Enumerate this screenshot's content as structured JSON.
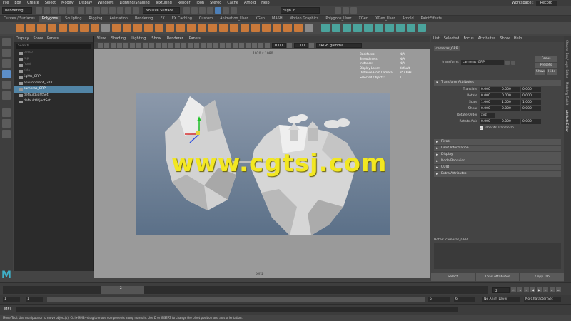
{
  "menubar": {
    "items": [
      "File",
      "Edit",
      "Create",
      "Select",
      "Modify",
      "Display",
      "Windows",
      "Lighting/Shading",
      "Texturing",
      "Render",
      "Toon",
      "Stereo",
      "Cache",
      "Arnold",
      "Help"
    ],
    "workspace_label": "Workspace :",
    "workspace_value": "Record"
  },
  "statusline": {
    "mode": "Rendering",
    "no_live_surface": "No Live Surface",
    "sign_in": "Sign In"
  },
  "shelf": {
    "tabs": [
      "Curves / Surfaces",
      "Polygons",
      "Sculpting",
      "Rigging",
      "Animation",
      "Rendering",
      "FX",
      "FX Caching",
      "Custom",
      "Animation_User",
      "XGen",
      "MASH",
      "Motion Graphics",
      "Polygons_User",
      "XGen",
      "XGen_User",
      "Arnold",
      "PaintEffects"
    ],
    "active_tab": 1
  },
  "outliner": {
    "menu": [
      "Display",
      "Show",
      "Panels"
    ],
    "search_placeholder": "Search...",
    "items": [
      {
        "label": "persp",
        "dim": true,
        "selected": false
      },
      {
        "label": "top",
        "dim": true,
        "selected": false
      },
      {
        "label": "front",
        "dim": true,
        "selected": false
      },
      {
        "label": "side",
        "dim": true,
        "selected": false
      },
      {
        "label": "lights_GRP",
        "dim": false,
        "selected": false
      },
      {
        "label": "environment_GRP",
        "dim": false,
        "selected": false
      },
      {
        "label": "cameras_GRP",
        "dim": false,
        "selected": true
      },
      {
        "label": "defaultLightSet",
        "dim": false,
        "selected": false
      },
      {
        "label": "defaultObjectSet",
        "dim": false,
        "selected": false
      }
    ]
  },
  "viewport": {
    "menu": [
      "View",
      "Shading",
      "Lighting",
      "Show",
      "Renderer",
      "Panels"
    ],
    "exposure": "0.00",
    "gamma": "1.00",
    "colorspace": "sRGB gamma",
    "resolution": "1920 x 1080",
    "hud": [
      {
        "k": "Backfaces:",
        "v": "N/A"
      },
      {
        "k": "Smoothness:",
        "v": "N/A"
      },
      {
        "k": "Instance:",
        "v": "N/A"
      },
      {
        "k": "Display Layer:",
        "v": "default"
      },
      {
        "k": "Distance From Camera:",
        "v": "957.693"
      },
      {
        "k": "Selected Objects:",
        "v": "1"
      }
    ],
    "camera_label": "persp",
    "watermark": "www.cgtsj.com"
  },
  "attribute_editor": {
    "menu": [
      "List",
      "Selected",
      "Focus",
      "Attributes",
      "Show",
      "Help"
    ],
    "tab": "cameras_GRP",
    "transform_label": "transform:",
    "transform_value": "cameras_GRP",
    "focus": "Focus",
    "presets": "Presets",
    "show": "Show",
    "hide": "Hide",
    "section_transform": "Transform Attributes",
    "rows": [
      {
        "label": "Translate",
        "values": [
          "0.000",
          "0.000",
          "0.000"
        ]
      },
      {
        "label": "Rotate",
        "values": [
          "0.000",
          "0.000",
          "0.000"
        ]
      },
      {
        "label": "Scale",
        "values": [
          "1.000",
          "1.000",
          "1.000"
        ]
      },
      {
        "label": "Shear",
        "values": [
          "0.000",
          "0.000",
          "0.000"
        ]
      }
    ],
    "rotate_order_label": "Rotate Order",
    "rotate_order_value": "xyz",
    "rotate_axis_label": "Rotate Axis",
    "rotate_axis_values": [
      "0.000",
      "0.000",
      "0.000"
    ],
    "inherits_transform": "Inherits Transform",
    "sections": [
      "Pivots",
      "Limit Information",
      "Display",
      "Node Behavior",
      "UUID",
      "Extra Attributes"
    ],
    "notes_label": "Notes: cameras_GRP",
    "buttons": [
      "Select",
      "Load Attributes",
      "Copy Tab"
    ]
  },
  "vtabs": [
    "Channel Box / Layer Editor",
    "Modeling Toolkit",
    "Attribute Editor"
  ],
  "timeline": {
    "current_frame": "2",
    "frame_field": "2",
    "range_start": "1",
    "range_inner_start": "1",
    "range_inner_end": "5",
    "range_end": "5",
    "range_max": "6",
    "no_anim_layer": "No Anim Layer",
    "no_char_set": "No Character Set",
    "fps": "24 fps"
  },
  "command": {
    "mel": "MEL"
  },
  "helpline": "Move Tool: Use manipulator to move object(s). Ctrl+MMB+drag to move components along normals. Use D or INSERT to change the pivot position and axis orientation."
}
